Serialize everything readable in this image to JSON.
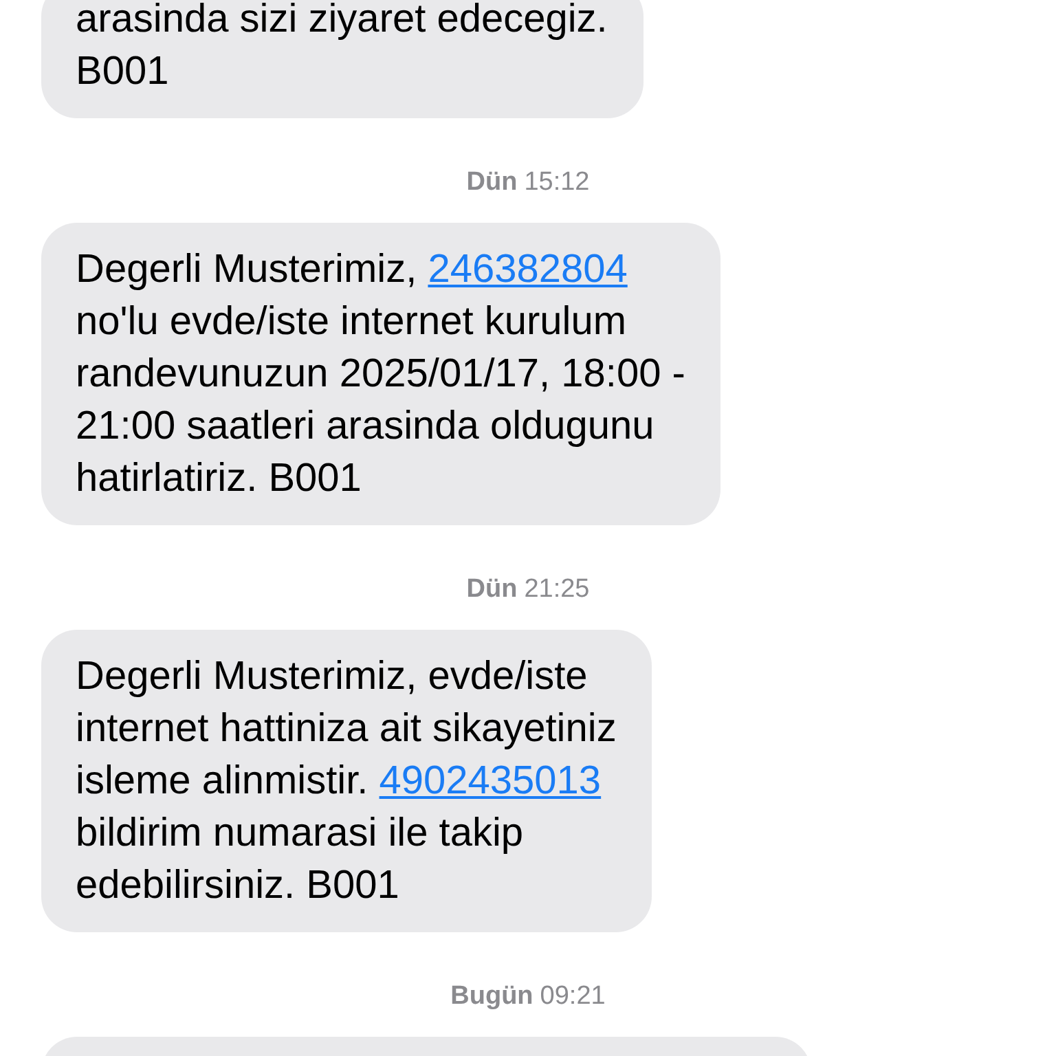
{
  "thread": [
    {
      "kind": "message",
      "lines": [
        [
          {
            "text": "arasinda sizi ziyaret edecegiz."
          }
        ],
        [
          {
            "text": "B001"
          }
        ]
      ]
    },
    {
      "kind": "timestamp",
      "day": "Dün",
      "time": "15:12"
    },
    {
      "kind": "message",
      "lines": [
        [
          {
            "text": "Degerli Musterimiz, "
          },
          {
            "text": "246382804",
            "link": true
          }
        ],
        [
          {
            "text": "no'lu evde/iste internet kurulum"
          }
        ],
        [
          {
            "text": "randevunuzun 2025/01/17, 18:00 -"
          }
        ],
        [
          {
            "text": "21:00 saatleri arasinda oldugunu"
          }
        ],
        [
          {
            "text": "hatirlatiriz. B001"
          }
        ]
      ]
    },
    {
      "kind": "timestamp",
      "day": "Dün",
      "time": "21:25"
    },
    {
      "kind": "message",
      "lines": [
        [
          {
            "text": "Degerli Musterimiz, evde/iste"
          }
        ],
        [
          {
            "text": "internet hattiniza ait sikayetiniz"
          }
        ],
        [
          {
            "text": "isleme alinmistir. "
          },
          {
            "text": "4902435013",
            "link": true
          }
        ],
        [
          {
            "text": "bildirim numarasi ile takip"
          }
        ],
        [
          {
            "text": "edebilirsiniz. B001"
          }
        ]
      ]
    },
    {
      "kind": "timestamp",
      "day": "Bugün",
      "time": "09:21"
    },
    {
      "kind": "clipped_message"
    }
  ]
}
